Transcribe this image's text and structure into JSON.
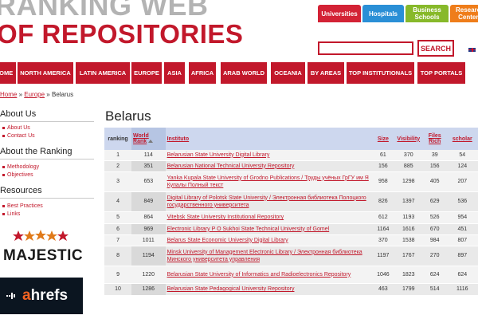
{
  "header": {
    "logo_line1": "RANKING WEB",
    "logo_line2": "OF REPOSITORIES",
    "tabs": [
      {
        "label": "Universities",
        "color": "#d32235"
      },
      {
        "label": "Hospitals",
        "color": "#2a8fd6"
      },
      {
        "label": "Business Schools",
        "color": "#87b92a"
      },
      {
        "label": "Research Centers",
        "color": "#ef7d1a"
      }
    ],
    "search": {
      "placeholder": "",
      "value": "",
      "button_label": "SEARCH"
    },
    "language_icon": "uk-flag-icon"
  },
  "nav": {
    "items": [
      "HOME",
      "NORTH AMERICA",
      "LATIN AMERICA",
      "EUROPE",
      "ASIA",
      "AFRICA",
      "ARAB WORLD",
      "OCEANIA",
      "BY AREAS",
      "TOP INSTITUTIONALS",
      "TOP PORTALS"
    ]
  },
  "breadcrumb": {
    "home": "Home",
    "sep1": "»",
    "region": "Europe",
    "sep2": "»",
    "current": "Belarus"
  },
  "sidebar": {
    "sections": [
      {
        "heading": "About Us",
        "links": [
          "About Us",
          "Contact Us"
        ]
      },
      {
        "heading": "About the Ranking",
        "links": [
          "Methodology",
          "Objectives"
        ]
      },
      {
        "heading": "Resources",
        "links": [
          "Best Practices",
          "Links"
        ]
      }
    ],
    "logos": {
      "majestic": "MAJESTIC",
      "ahrefs_a": "a",
      "ahrefs_rest": "hrefs"
    }
  },
  "main": {
    "title": "Belarus",
    "table": {
      "headers": {
        "ranking": "ranking",
        "world_rank_1": "World",
        "world_rank_2": "Rank",
        "institution": "Instituto",
        "size": "Size",
        "visibility": "Visibility",
        "files_rich_1": "Files",
        "files_rich_2": "Rich",
        "scholar": "scholar"
      },
      "rows": [
        {
          "ranking": "1",
          "world_rank": "114",
          "institution": "Belarusian State University Digital Library",
          "size": "61",
          "visibility": "370",
          "files_rich": "39",
          "scholar": "54"
        },
        {
          "ranking": "2",
          "world_rank": "351",
          "institution": "Belarusian National Technical University Repository",
          "size": "156",
          "visibility": "885",
          "files_rich": "156",
          "scholar": "124"
        },
        {
          "ranking": "3",
          "world_rank": "653",
          "institution": "Yanka Kupala State University of Grodno Publications / Труды учёных ГрГУ им Я Купалы Полный текст",
          "size": "958",
          "visibility": "1298",
          "files_rich": "405",
          "scholar": "207"
        },
        {
          "ranking": "4",
          "world_rank": "849",
          "institution": "Digital Library of Polotsk State University / Электронная библиотека Полоцкого государственного университета",
          "size": "826",
          "visibility": "1397",
          "files_rich": "629",
          "scholar": "536"
        },
        {
          "ranking": "5",
          "world_rank": "864",
          "institution": "Vitebsk State University Institutional Repository",
          "size": "612",
          "visibility": "1193",
          "files_rich": "526",
          "scholar": "954"
        },
        {
          "ranking": "6",
          "world_rank": "969",
          "institution": "Electronic Library P O Sukhoi State Technical University of Gomel",
          "size": "1164",
          "visibility": "1616",
          "files_rich": "670",
          "scholar": "451"
        },
        {
          "ranking": "7",
          "world_rank": "1011",
          "institution": "Belarus State Economic University Digital Library",
          "size": "370",
          "visibility": "1538",
          "files_rich": "984",
          "scholar": "807"
        },
        {
          "ranking": "8",
          "world_rank": "1194",
          "institution": "Minsk University of Management Electronic Library / Электронная библиотека Минского университета управления",
          "size": "1197",
          "visibility": "1767",
          "files_rich": "270",
          "scholar": "897"
        },
        {
          "ranking": "9",
          "world_rank": "1220",
          "institution": "Belarusian State University of Informatics and Radioelectronics Repository",
          "size": "1046",
          "visibility": "1823",
          "files_rich": "624",
          "scholar": "624"
        },
        {
          "ranking": "10",
          "world_rank": "1286",
          "institution": "Belarusian State Pedagogical University Repository",
          "size": "463",
          "visibility": "1799",
          "files_rich": "514",
          "scholar": "1116"
        }
      ]
    }
  },
  "colors": {
    "brand_red": "#c2182b",
    "table_header": "#cdd7ee",
    "logo_gray": "#b3b3b3"
  }
}
